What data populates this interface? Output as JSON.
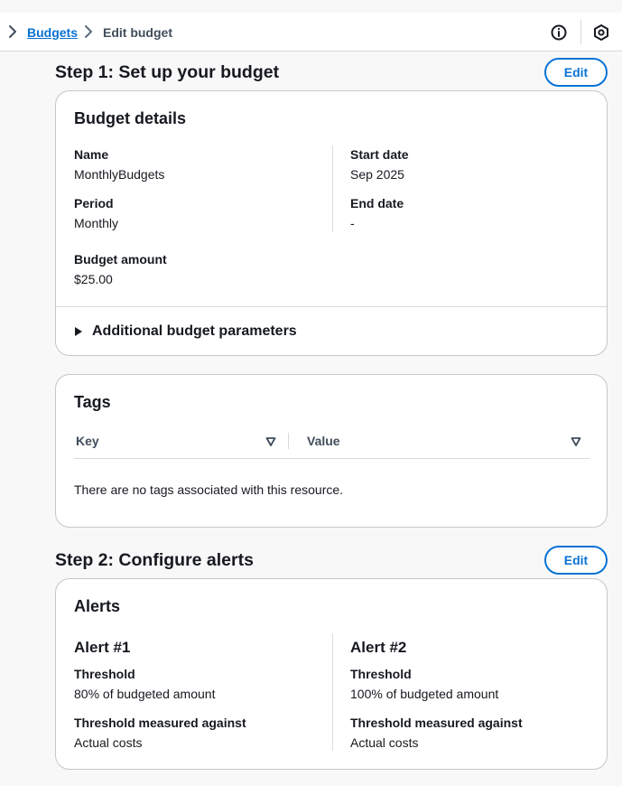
{
  "breadcrumb": {
    "link": "Budgets",
    "current": "Edit budget"
  },
  "step1": {
    "title": "Step 1: Set up your budget",
    "edit_label": "Edit",
    "details": {
      "title": "Budget details",
      "name_label": "Name",
      "name_value": "MonthlyBudgets",
      "period_label": "Period",
      "period_value": "Monthly",
      "budget_amount_label": "Budget amount",
      "budget_amount_value": "$25.00",
      "start_date_label": "Start date",
      "start_date_value": "Sep 2025",
      "end_date_label": "End date",
      "end_date_value": "-",
      "expander_label": "Additional budget parameters"
    },
    "tags": {
      "title": "Tags",
      "columns": [
        "Key",
        "Value"
      ],
      "empty_text": "There are no tags associated with this resource."
    }
  },
  "step2": {
    "title": "Step 2: Configure alerts",
    "edit_label": "Edit",
    "alerts": {
      "title": "Alerts",
      "items": [
        {
          "heading": "Alert #1",
          "threshold_label": "Threshold",
          "threshold_value": "80% of budgeted amount",
          "measured_label": "Threshold measured against",
          "measured_value": "Actual costs"
        },
        {
          "heading": "Alert #2",
          "threshold_label": "Threshold",
          "threshold_value": "100% of budgeted amount",
          "measured_label": "Threshold measured against",
          "measured_value": "Actual costs"
        }
      ]
    }
  },
  "icons": {
    "info": "info-icon",
    "settings": "hexagon-icon",
    "nav": "chevron-right-icon"
  },
  "colors": {
    "link": "#0972d3",
    "border": "#c6c6cd",
    "background": "#f8f8f8"
  }
}
